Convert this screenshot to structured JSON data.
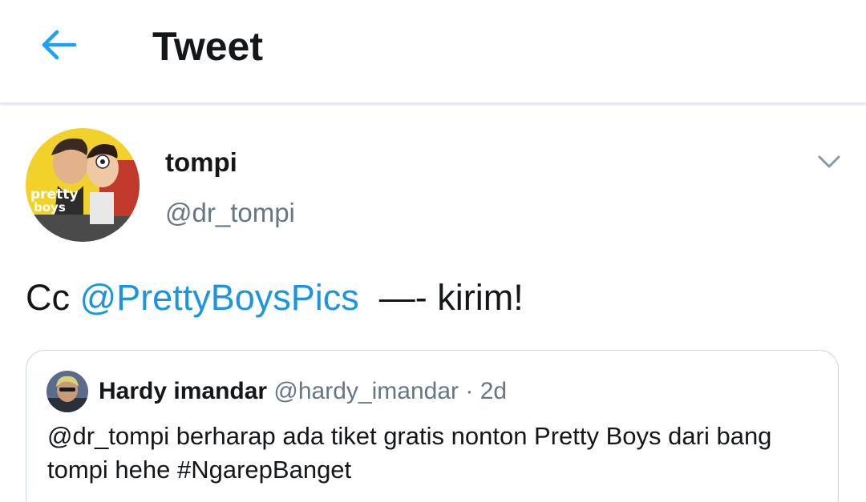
{
  "header": {
    "back_icon": "arrow-left-icon",
    "title": "Tweet"
  },
  "tweet": {
    "author": {
      "display_name": "tompi",
      "handle": "@dr_tompi",
      "avatar_text": "pretty boys"
    },
    "caret_icon": "chevron-down-icon",
    "text_prefix": "Cc ",
    "mention": "@PrettyBoysPics",
    "text_suffix": "  —- kirim!"
  },
  "quoted_tweet": {
    "display_name": "Hardy imandar",
    "handle": "@hardy_imandar",
    "separator": "·",
    "time": "2d",
    "text": "@dr_tompi berharap ada tiket gratis nonton Pretty Boys dari bang tompi hehe #NgarepBanget"
  },
  "colors": {
    "accent": "#1b95e0",
    "text_primary": "#14171a",
    "text_secondary": "#657786",
    "border": "#ccd6dd"
  }
}
